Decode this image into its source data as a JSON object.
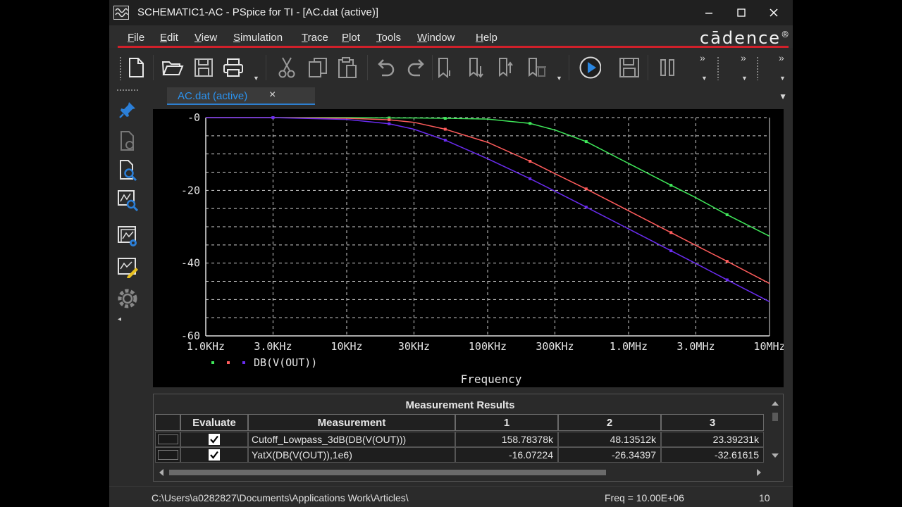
{
  "window": {
    "title": "SCHEMATIC1-AC - PSpice for TI - [AC.dat (active)]",
    "controls": [
      "minimize",
      "maximize",
      "close"
    ]
  },
  "menu": [
    {
      "pre": "",
      "ul": "F",
      "post": "ile"
    },
    {
      "pre": "",
      "ul": "E",
      "post": "dit"
    },
    {
      "pre": "",
      "ul": "V",
      "post": "iew"
    },
    {
      "pre": "",
      "ul": "S",
      "post": "imulation"
    },
    {
      "pre": "",
      "ul": "T",
      "post": "race"
    },
    {
      "pre": "",
      "ul": "P",
      "post": "lot"
    },
    {
      "pre": "",
      "ul": "T",
      "post": "ools"
    },
    {
      "pre": "",
      "ul": "W",
      "post": "indow"
    },
    {
      "pre": "",
      "ul": "H",
      "post": "elp"
    }
  ],
  "brand": {
    "logo_text": "cādence",
    "reg": "®",
    "accent": "#d0202a"
  },
  "toolbar_icons": [
    "new-file-icon",
    "open-folder-icon",
    "save-icon",
    "print-icon",
    "cut-icon",
    "copy-icon",
    "paste-icon",
    "undo-icon",
    "redo-icon",
    "bookmark-icon",
    "bookmark-down-icon",
    "bookmark-up-icon",
    "bookmark-clear-icon",
    "run-icon",
    "save-layout-icon",
    "pause-icon"
  ],
  "sidebar_icons": [
    "pin-icon",
    "document-icon",
    "zoom-document-icon",
    "zoom-plot-icon",
    "plot-settings-icon",
    "plot-edit-icon",
    "gear-icon"
  ],
  "tab": {
    "label": "AC.dat (active)",
    "close": "×",
    "active_color": "#2b93f0"
  },
  "chart_data": {
    "type": "line",
    "xlabel": "Frequency",
    "x_scale": "log",
    "x_ticks": [
      "1.0KHz",
      "3.0KHz",
      "10KHz",
      "30KHz",
      "100KHz",
      "300KHz",
      "1.0MHz",
      "3.0MHz",
      "10MHz"
    ],
    "x_tick_values": [
      1000,
      3000,
      10000,
      30000,
      100000,
      300000,
      1000000,
      3000000,
      10000000
    ],
    "y_ticks": [
      "-0",
      "-20",
      "-40",
      "-60"
    ],
    "y_tick_values": [
      0,
      -20,
      -40,
      -60
    ],
    "ylim": [
      -60,
      0
    ],
    "xlim": [
      1000,
      10000000
    ],
    "grid": true,
    "legend_label": "DB(V(OUT))",
    "x": [
      1000,
      3000,
      10000,
      20000,
      30000,
      50000,
      100000,
      200000,
      300000,
      500000,
      1000000,
      2000000,
      3000000,
      5000000,
      10000000
    ],
    "series": [
      {
        "color": "#3fe85a",
        "values": [
          0,
          0,
          0,
          -0.1,
          -0.1,
          -0.2,
          -0.4,
          -1.6,
          -3.4,
          -6.6,
          -12.6,
          -18.6,
          -22,
          -26.7,
          -32.6
        ]
      },
      {
        "color": "#ff5c5c",
        "values": [
          0,
          0,
          -0.2,
          -0.6,
          -1.3,
          -3.2,
          -6.8,
          -12,
          -15.4,
          -19.6,
          -25.6,
          -31.6,
          -35.1,
          -39.5,
          -45.6
        ]
      },
      {
        "color": "#6a2cf0",
        "values": [
          0,
          0,
          -0.5,
          -1.7,
          -3.2,
          -6.2,
          -11.3,
          -16.8,
          -20.2,
          -24.6,
          -30.6,
          -36.6,
          -40.1,
          -44.6,
          -50.6
        ]
      }
    ]
  },
  "results": {
    "title": "Measurement Results",
    "headers": [
      "Evaluate",
      "Measurement",
      "1",
      "2",
      "3"
    ],
    "rows": [
      {
        "measurement": "Cutoff_Lowpass_3dB(DB(V(OUT)))",
        "v1": "158.78378k",
        "v2": "48.13512k",
        "v3": "23.39231k",
        "checked": true
      },
      {
        "measurement": "YatX(DB(V(OUT)),1e6)",
        "v1": "-16.07224",
        "v2": "-26.34397",
        "v3": "-32.61615",
        "checked": true
      }
    ]
  },
  "status": {
    "path": "C:\\Users\\a0282827\\Documents\\Applications Work\\Articles\\",
    "freq_label": "Freq =",
    "freq_value": "10.00E+06",
    "right": "10"
  }
}
